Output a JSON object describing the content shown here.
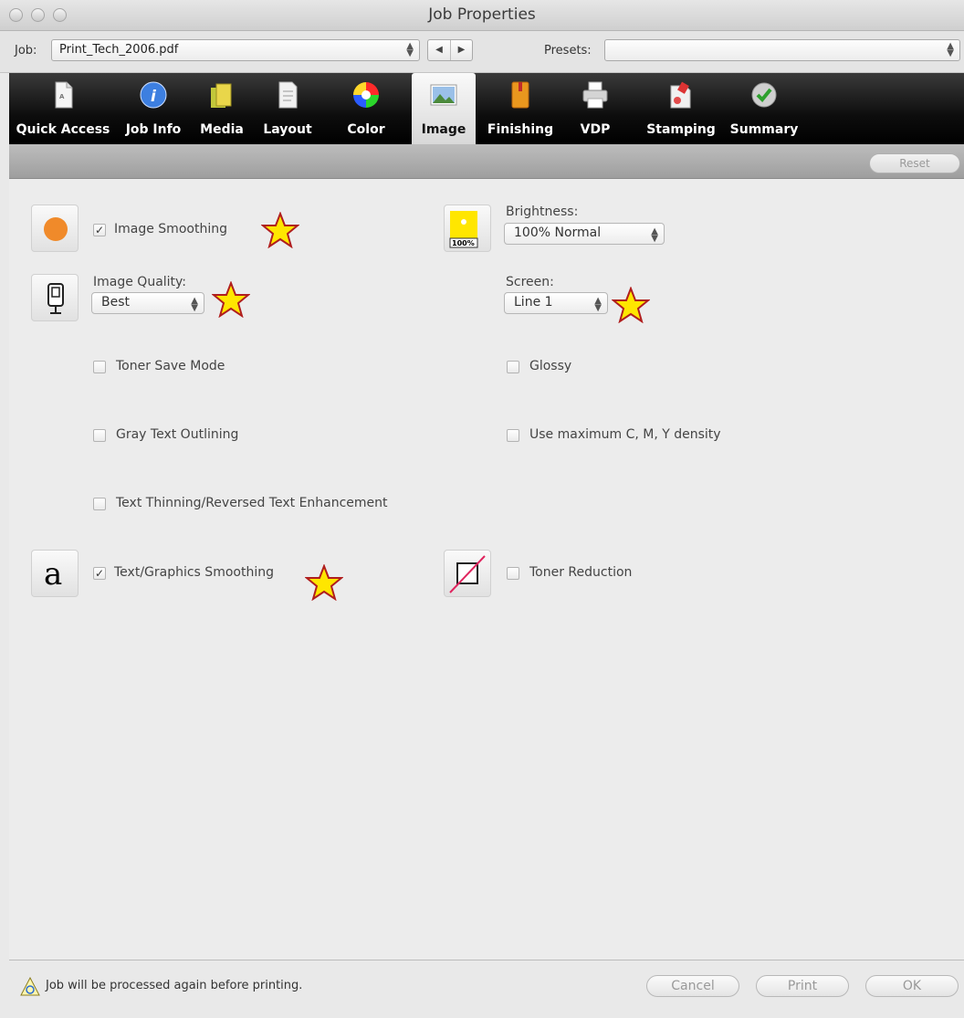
{
  "window": {
    "title": "Job Properties"
  },
  "jobrow": {
    "job_label": "Job:",
    "job_value": "Print_Tech_2006.pdf",
    "presets_label": "Presets:",
    "presets_value": ""
  },
  "toolbar": {
    "tabs": [
      {
        "label": "Quick Access",
        "icon": "document-icon"
      },
      {
        "label": "Job Info",
        "icon": "info-icon"
      },
      {
        "label": "Media",
        "icon": "media-icon"
      },
      {
        "label": "Layout",
        "icon": "layout-icon"
      },
      {
        "label": "Color",
        "icon": "color-wheel-icon"
      },
      {
        "label": "Image",
        "icon": "image-icon",
        "active": true
      },
      {
        "label": "Finishing",
        "icon": "finishing-icon"
      },
      {
        "label": "VDP",
        "icon": "printer-icon"
      },
      {
        "label": "Stamping",
        "icon": "stamping-icon"
      },
      {
        "label": "Summary",
        "icon": "checkmark-icon"
      }
    ]
  },
  "subbar": {
    "reset_label": "Reset"
  },
  "options": {
    "image_smoothing": {
      "label": "Image Smoothing",
      "checked": true
    },
    "image_quality": {
      "label": "Image Quality:",
      "value": "Best"
    },
    "toner_save": {
      "label": "Toner Save Mode",
      "checked": false
    },
    "gray_text": {
      "label": "Gray Text Outlining",
      "checked": false
    },
    "text_thinning": {
      "label": "Text Thinning/Reversed Text Enhancement",
      "checked": false
    },
    "text_graphics_smoothing": {
      "label": "Text/Graphics Smoothing",
      "checked": true
    },
    "brightness": {
      "label": "Brightness:",
      "value": "100% Normal",
      "icon_text": "100%"
    },
    "screen": {
      "label": "Screen:",
      "value": "Line 1"
    },
    "glossy": {
      "label": "Glossy",
      "checked": false
    },
    "max_density": {
      "label": "Use maximum C, M, Y density",
      "checked": false
    },
    "toner_reduction": {
      "label": "Toner Reduction",
      "checked": false
    },
    "text_icon_glyph": "a"
  },
  "footer": {
    "status": "Job will be processed again before printing.",
    "cancel_label": "Cancel",
    "print_label": "Print",
    "ok_label": "OK"
  },
  "colors": {
    "star_fill": "#ffe600",
    "star_stroke": "#b01e1e",
    "toolbar_bg": "#000000"
  }
}
